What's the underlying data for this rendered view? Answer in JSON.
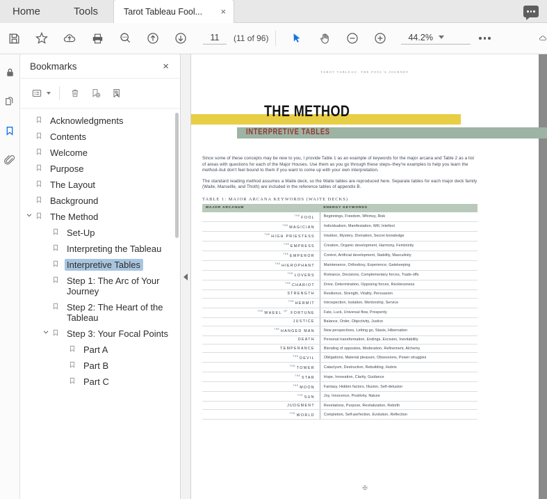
{
  "tabbar": {
    "home_label": "Home",
    "tools_label": "Tools",
    "document_tab_title": "Tarot Tableau Fool...",
    "close_glyph": "×",
    "comment_icon": "comment-bubble-icon"
  },
  "toolbar": {
    "save_icon": "save-icon",
    "star_icon": "star-icon",
    "upload_cloud_icon": "upload-cloud-icon",
    "print_icon": "print-icon",
    "search_icon": "search-icon",
    "previous_page_icon": "arrow-up-circle-icon",
    "next_page_icon": "arrow-down-circle-icon",
    "page_number": "11",
    "page_count_label": "(11 of 96)",
    "select_tool_icon": "cursor-arrow-icon",
    "hand_tool_icon": "hand-icon",
    "zoom_out_icon": "minus-circle-icon",
    "zoom_in_icon": "plus-circle-icon",
    "zoom_level": "44.2%",
    "more_tools_icon": "ellipsis-icon",
    "overflow_icon": "partial-cloud-icon",
    "accent_color": "#1473e6"
  },
  "rail": {
    "items": [
      {
        "name": "security-lock-icon",
        "label": "Protect",
        "active": false
      },
      {
        "name": "page-thumbnails-icon",
        "label": "Page Thumbnails",
        "active": false
      },
      {
        "name": "bookmark-icon",
        "label": "Bookmarks",
        "active": true
      },
      {
        "name": "attachments-paperclip-icon",
        "label": "Attachments",
        "active": false
      }
    ]
  },
  "panel": {
    "title": "Bookmarks",
    "close_glyph": "×",
    "tools": [
      {
        "name": "bookmark-options-icon",
        "label": "Options"
      },
      {
        "name": "delete-bookmark-icon",
        "label": "Delete Bookmark"
      },
      {
        "name": "new-bookmark-icon",
        "label": "New Bookmark"
      },
      {
        "name": "bookmark-select-icon",
        "label": "Select Bookmark"
      }
    ],
    "bookmarks": [
      {
        "label": "Acknowledgments",
        "level": 0,
        "expandable": false,
        "expanded": false,
        "selected": false
      },
      {
        "label": "Contents",
        "level": 0,
        "expandable": false,
        "expanded": false,
        "selected": false
      },
      {
        "label": "Welcome",
        "level": 0,
        "expandable": false,
        "expanded": false,
        "selected": false
      },
      {
        "label": "Purpose",
        "level": 0,
        "expandable": false,
        "expanded": false,
        "selected": false
      },
      {
        "label": "The Layout",
        "level": 0,
        "expandable": false,
        "expanded": false,
        "selected": false
      },
      {
        "label": "Background",
        "level": 0,
        "expandable": false,
        "expanded": false,
        "selected": false
      },
      {
        "label": "The Method",
        "level": 0,
        "expandable": true,
        "expanded": true,
        "selected": false
      },
      {
        "label": "Set-Up",
        "level": 1,
        "expandable": false,
        "expanded": false,
        "selected": false
      },
      {
        "label": "Interpreting the Tableau",
        "level": 1,
        "expandable": false,
        "expanded": false,
        "selected": false
      },
      {
        "label": "Interpretive Tables",
        "level": 1,
        "expandable": false,
        "expanded": false,
        "selected": true
      },
      {
        "label": "Step 1: The Arc of Your Journey",
        "level": 1,
        "expandable": false,
        "expanded": false,
        "selected": false
      },
      {
        "label": "Step 2: The Heart of the Tableau",
        "level": 1,
        "expandable": false,
        "expanded": false,
        "selected": false
      },
      {
        "label": "Step 3: Your Focal Points",
        "level": 1,
        "expandable": true,
        "expanded": true,
        "selected": false
      },
      {
        "label": "Part A",
        "level": 2,
        "expandable": false,
        "expanded": false,
        "selected": false
      },
      {
        "label": "Part B",
        "level": 2,
        "expandable": false,
        "expanded": false,
        "selected": false
      },
      {
        "label": "Part C",
        "level": 2,
        "expandable": false,
        "expanded": false,
        "selected": false
      }
    ],
    "selected_highlight_color": "#a8c5e0"
  },
  "collapse_handle": {
    "name": "collapse-panel-handle",
    "glyph": "◀"
  },
  "document": {
    "running_header": "TAROT TABLEAU: THE FOOL'S JOURNEY",
    "main_title": "THE METHOD",
    "section_subtitle": "INTERPRETIVE TABLES",
    "yellow_band_color": "#e8ce44",
    "green_band_color": "#9db3a3",
    "subtitle_color": "#8f3a31",
    "paragraphs": [
      "Since some of these concepts may be new to you, I provide Table 1 as an example of keywords for the major arcana and Table 2 as a list of areas with questions for each of the Major Houses. Use them as you go through these steps–they're examples to help you learn the method–but don't feel bound to them if you want to come up with your own interpretation.",
      "The standard reading method assumes a Waite deck, so the Waite tables are reproduced here. Separate tables for each major deck family (Waite, Marseille, and Thoth) are included in the reference tables of appendix B."
    ],
    "table_caption": "TABLE 1: MAJOR ARCANA KEYWORDS (WAITE DECKS)",
    "table": {
      "header_bg": "#b9c9bb",
      "columns": [
        "MAJOR ARCANUM",
        "ENERGY KEYWORDS"
      ],
      "rows": [
        {
          "prefix": "THE",
          "name": "FOOL",
          "keywords": "Beginnings, Freedom, Whimsy, Risk"
        },
        {
          "prefix": "THE",
          "name": "MAGICIAN",
          "keywords": "Individualism, Manifestation, Will, Intellect"
        },
        {
          "prefix": "THE",
          "name": "HIGH PRIESTESS",
          "keywords": "Intuition, Mystery, Divination, Secret knowledge"
        },
        {
          "prefix": "THE",
          "name": "EMPRESS",
          "keywords": "Creation, Organic development, Harmony, Femininity"
        },
        {
          "prefix": "THE",
          "name": "EMPEROR",
          "keywords": "Control, Artificial development, Stability, Masculinity"
        },
        {
          "prefix": "THE",
          "name": "HIEROPHANT",
          "keywords": "Maintenance, Orthodoxy, Experience, Gatekeeping"
        },
        {
          "prefix": "THE",
          "name": "LOVERS",
          "keywords": "Romance, Decisions, Complementary forces, Trade-offs"
        },
        {
          "prefix": "THE",
          "name": "CHARIOT",
          "keywords": "Drive, Determination, Opposing forces, Recklessness"
        },
        {
          "prefix": "",
          "name": "STRENGTH",
          "keywords": "Resilience, Strength, Vitality, Persuasion"
        },
        {
          "prefix": "THE",
          "name": "HERMIT",
          "keywords": "Introspection, Isolation, Mentorship, Service"
        },
        {
          "prefix": "THE",
          "name": "WHEEL OF FORTUNE",
          "keywords": "Fate, Luck, Universal flow, Prosperity"
        },
        {
          "prefix": "",
          "name": "JUSTICE",
          "keywords": "Balance, Order, Objectivity, Justice"
        },
        {
          "prefix": "THE",
          "name": "HANGED MAN",
          "keywords": "New perspectives, Letting go, Stasis, Hibernation"
        },
        {
          "prefix": "",
          "name": "DEATH",
          "keywords": "Personal transformation, Endings, Excision, Inevitability"
        },
        {
          "prefix": "",
          "name": "TEMPERANCE",
          "keywords": "Blending of opposites, Moderation, Refinement, Alchemy"
        },
        {
          "prefix": "THE",
          "name": "DEVIL",
          "keywords": "Obligations, Material pleasure, Obsessions, Power struggles"
        },
        {
          "prefix": "THE",
          "name": "TOWER",
          "keywords": "Cataclysm, Destruction, Rebuilding, Hubris"
        },
        {
          "prefix": "THE",
          "name": "STAR",
          "keywords": "Hope, Innovation, Clarity, Guidance"
        },
        {
          "prefix": "THE",
          "name": "MOON",
          "keywords": "Fantasy, Hidden factors, Illusion, Self-delusion"
        },
        {
          "prefix": "THE",
          "name": "SUN",
          "keywords": "Joy, Innocence, Positivity, Nature"
        },
        {
          "prefix": "",
          "name": "JUDGMENT",
          "keywords": "Revelations, Purpose, Revitalization, Rebirth"
        },
        {
          "prefix": "THE",
          "name": "WORLD",
          "keywords": "Completion, Self-perfection, Evolution, Reflection"
        }
      ]
    },
    "footer_ornament": "✠"
  }
}
